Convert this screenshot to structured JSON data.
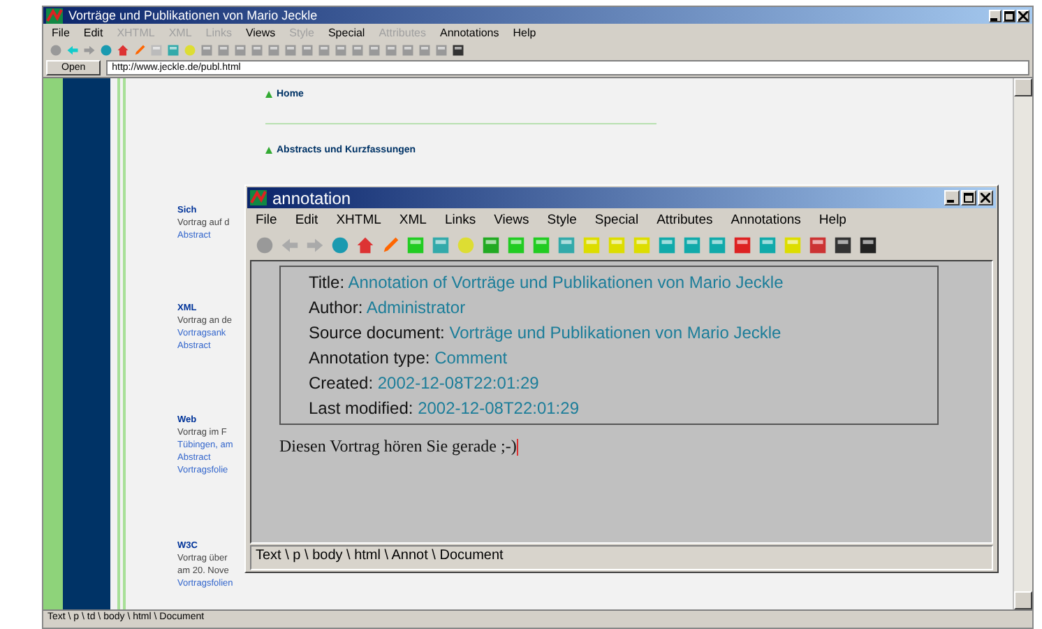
{
  "main_window": {
    "title": "Vorträge und Publikationen von Mario Jeckle",
    "menu": [
      {
        "label": "File",
        "disabled": false
      },
      {
        "label": "Edit",
        "disabled": false
      },
      {
        "label": "XHTML",
        "disabled": true
      },
      {
        "label": "XML",
        "disabled": true
      },
      {
        "label": "Links",
        "disabled": true
      },
      {
        "label": "Views",
        "disabled": false
      },
      {
        "label": "Style",
        "disabled": true
      },
      {
        "label": "Special",
        "disabled": false
      },
      {
        "label": "Attributes",
        "disabled": true
      },
      {
        "label": "Annotations",
        "disabled": false
      },
      {
        "label": "Help",
        "disabled": false
      }
    ],
    "open_button": "Open",
    "address": "http://www.jeckle.de/publ.html",
    "page": {
      "links": [
        "Home",
        "Abstracts und Kurzfassungen"
      ],
      "entries": [
        {
          "title": "Sich",
          "lines": [
            {
              "text": "Vortrag auf d",
              "link": false
            },
            {
              "text": "Abstract",
              "link": true
            }
          ]
        },
        {
          "title": "XML",
          "lines": [
            {
              "text": "Vortrag an de",
              "link": false
            },
            {
              "text": "Vortragsank",
              "link": true
            },
            {
              "text": "Abstract",
              "link": true
            }
          ]
        },
        {
          "title": "Web",
          "lines": [
            {
              "text": "Vortrag im F",
              "link": false
            },
            {
              "text": "Tübingen, am",
              "link": true
            },
            {
              "text": "Abstract",
              "link": true
            },
            {
              "text": "Vortragsfolie",
              "link": true
            }
          ]
        },
        {
          "title": "W3C",
          "lines": [
            {
              "text": "Vortrag über",
              "link": false
            },
            {
              "text": "am 20. Nove",
              "link": false
            },
            {
              "text": "Vortragsfolien",
              "link": true
            }
          ]
        }
      ]
    },
    "status_bar": "Text \\ p \\ td \\ body \\ html \\ Document"
  },
  "annotation_window": {
    "title": "annotation",
    "menu": [
      {
        "label": "File",
        "disabled": false
      },
      {
        "label": "Edit",
        "disabled": false
      },
      {
        "label": "XHTML",
        "disabled": false
      },
      {
        "label": "XML",
        "disabled": false
      },
      {
        "label": "Links",
        "disabled": false
      },
      {
        "label": "Views",
        "disabled": false
      },
      {
        "label": "Style",
        "disabled": false
      },
      {
        "label": "Special",
        "disabled": false
      },
      {
        "label": "Attributes",
        "disabled": false
      },
      {
        "label": "Annotations",
        "disabled": false
      },
      {
        "label": "Help",
        "disabled": false
      }
    ],
    "fields": [
      {
        "label": "Title:",
        "value": "Annotation of Vorträge und Publikationen von Mario Jeckle"
      },
      {
        "label": "Author:",
        "value": "Administrator"
      },
      {
        "label": "Source document:",
        "value": "Vorträge und Publikationen von Mario Jeckle"
      },
      {
        "label": "Annotation type:",
        "value": "Comment"
      },
      {
        "label": "Created:",
        "value": "2002-12-08T22:01:29"
      },
      {
        "label": "Last modified:",
        "value": "2002-12-08T22:01:29"
      }
    ],
    "comment": "Diesen Vortrag hören Sie gerade ;-)",
    "status_bar": "Text \\ p \\ body \\ html \\ Annot \\ Document"
  }
}
